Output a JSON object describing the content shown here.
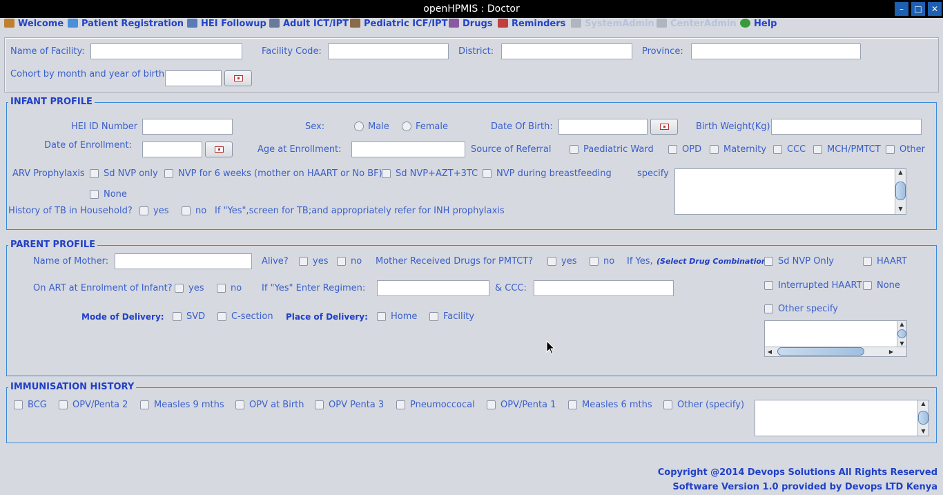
{
  "window": {
    "title": "openHPMIS : Doctor",
    "minimize": "–",
    "maximize": "□",
    "close": "✕"
  },
  "menu": [
    {
      "label": "Welcome",
      "icon": "house-icon",
      "color": "#c08030"
    },
    {
      "label": "Patient Registration",
      "icon": "nurse-icon",
      "color": "#4a90d9"
    },
    {
      "label": "HEI Followup",
      "icon": "notepad-icon",
      "color": "#5a7ab8"
    },
    {
      "label": "Adult ICT/IPT",
      "icon": "person-icon",
      "color": "#6a7a9a"
    },
    {
      "label": "Pediatric ICF/IPT",
      "icon": "family-icon",
      "color": "#8a6a4a"
    },
    {
      "label": "Drugs",
      "icon": "pills-icon",
      "color": "#8a5aa0"
    },
    {
      "label": "Reminders",
      "icon": "reminder-icon",
      "color": "#c04040"
    },
    {
      "label": "SystemAdmin",
      "icon": "wrench-icon",
      "color": "#9aa0aa"
    },
    {
      "label": "CenterAdmin",
      "icon": "key-icon",
      "color": "#9aa0aa"
    },
    {
      "label": "Help",
      "icon": "help-icon",
      "color": "#3a9a3a"
    }
  ],
  "facility": {
    "name_label": "Name of Facility:",
    "code_label": "Facility Code:",
    "district_label": "District:",
    "province_label": "Province:",
    "cohort_label": "Cohort by month and year of birth:"
  },
  "infant": {
    "title": "INFANT PROFILE",
    "hei_label": "HEI ID Number",
    "sex_label": "Sex:",
    "male": "Male",
    "female": "Female",
    "dob_label": "Date Of Birth:",
    "weight_label": "Birth Weight(Kg)",
    "enroll_label": "Date of Enrollment:",
    "age_label": "Age at Enrollment:",
    "referral_label": "Source of Referral",
    "referral_options": [
      "Paediatric Ward",
      "OPD",
      "Maternity",
      "CCC",
      "MCH/PMTCT",
      "Other"
    ],
    "arv_label": "ARV Prophylaxis",
    "arv_options": [
      "Sd NVP only",
      "NVP for 6 weeks (mother on HAART or No BF)",
      "Sd NVP+AZT+3TC",
      "NVP during breastfeeding",
      "None"
    ],
    "specify_label": "specify",
    "tb_label": "History of TB in Household?",
    "yes": "yes",
    "no": "no",
    "tb_note": "If \"Yes\",screen for TB;and appropriately refer for INH prophylaxis"
  },
  "parent": {
    "title": "PARENT PROFILE",
    "mother_label": "Name of Mother:",
    "alive_label": "Alive?",
    "yes": "yes",
    "no": "no",
    "pmtct_label": "Mother Received Drugs for PMTCT?",
    "ifyes_label": "If Yes,",
    "select_combo": "(Select Drug Combination)",
    "drug_options": [
      "Sd NVP Only",
      "HAART",
      "Interrupted HAART",
      "None",
      "Other specify"
    ],
    "art_label": "On ART at Enrolment of Infant?",
    "regimen_label": "If \"Yes\" Enter Regimen:",
    "ccc_label": "& CCC:",
    "delivery_mode_label": "Mode of Delivery:",
    "svd": "SVD",
    "csection": "C-section",
    "delivery_place_label": "Place of Delivery:",
    "home": "Home",
    "facility": "Facility"
  },
  "immunisation": {
    "title": "IMMUNISATION HISTORY",
    "options": [
      "BCG",
      "OPV/Penta 2",
      "Measles 9 mths",
      "OPV at Birth",
      "OPV Penta 3",
      "Pneumoccocal",
      "OPV/Penta 1",
      "Measles 6 mths",
      "Other (specify)"
    ]
  },
  "footer": {
    "copyright": "Copyright @2014 Devops Solutions All Rights Reserved",
    "version": "Software Version 1.0 provided by Devops LTD Kenya"
  }
}
